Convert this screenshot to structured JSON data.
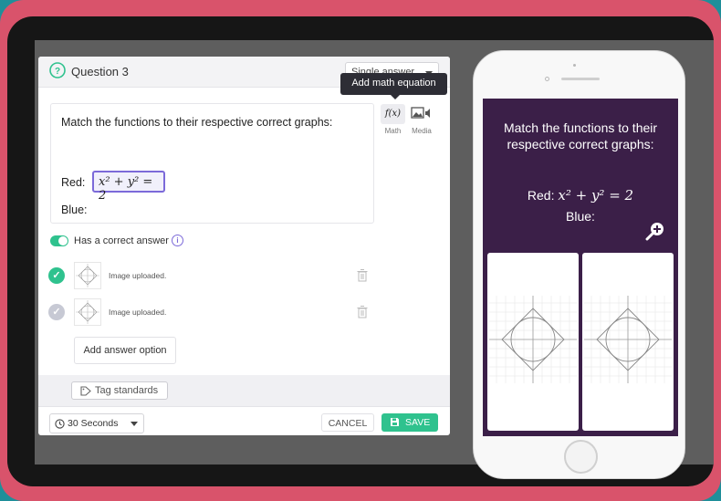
{
  "editor": {
    "title": "Question 3",
    "question_type": "Single answer",
    "tooltip": "Add math equation",
    "question_text": "Match the functions to their respective correct graphs:",
    "red_label": "Red:",
    "red_equation": "x² + y² = 2",
    "blue_label": "Blue:",
    "tools": [
      {
        "label": "Math",
        "glyph": "f(x)",
        "icon": "function-icon"
      },
      {
        "label": "Media",
        "icon": "media-icon"
      }
    ],
    "correct_answer_toggle": {
      "label": "Has a correct answer",
      "on": true
    },
    "answers": [
      {
        "status": "Image uploaded.",
        "correct": true
      },
      {
        "status": "Image uploaded.",
        "correct": false
      }
    ],
    "add_option_label": "Add answer option",
    "tag_standards_label": "Tag standards",
    "timer": "30 Seconds",
    "cancel_label": "CANCEL",
    "save_label": "SAVE"
  },
  "preview": {
    "question_text": "Match the functions to their respective correct graphs:",
    "red_label": "Red:",
    "red_equation": "x² + y² = 2",
    "blue_label": "Blue:"
  },
  "colors": {
    "accent_green": "#2fc28e",
    "accent_purple": "#7c6ad9",
    "preview_bg": "#3b1f48",
    "tablet_frame": "#d9536b"
  }
}
